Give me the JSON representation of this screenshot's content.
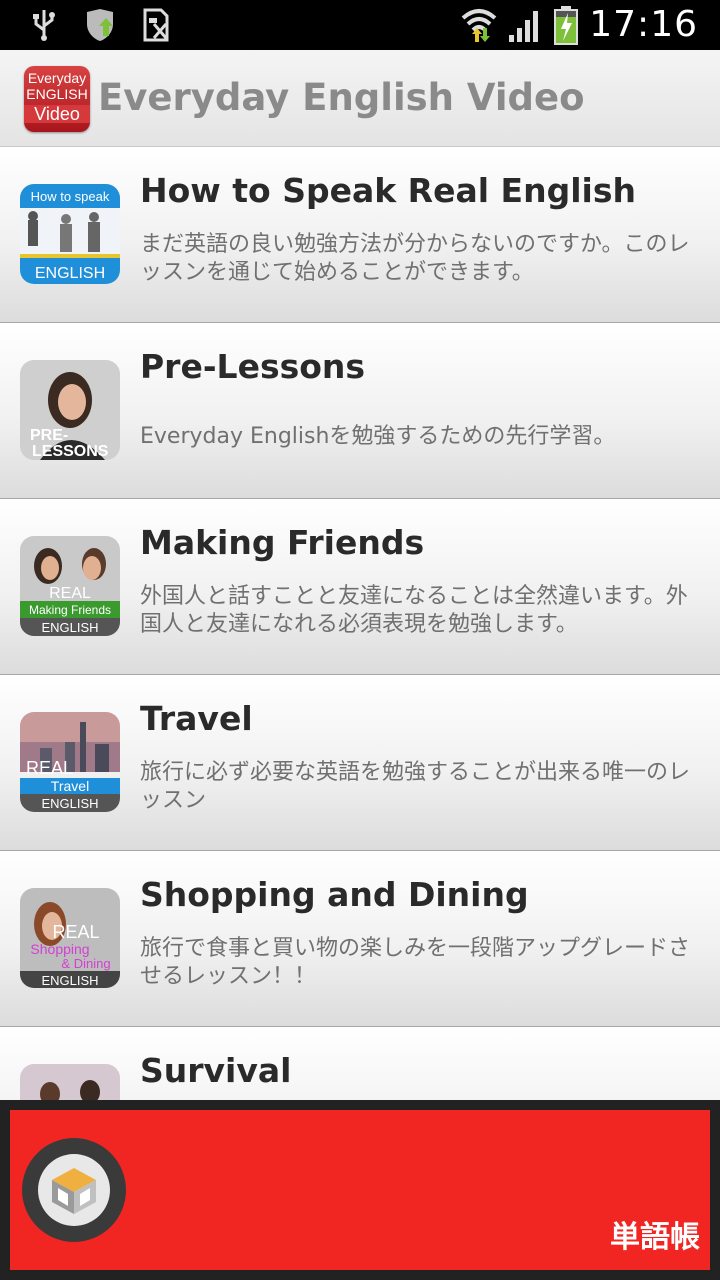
{
  "status_bar": {
    "time": "17:16"
  },
  "header": {
    "logo_lines": [
      "Everyday",
      "ENGLISH",
      "Video"
    ],
    "title": "Everyday English Video"
  },
  "lessons": [
    {
      "title": "How to Speak Real English",
      "description": "まだ英語の良い勉強方法が分からないのですか。このレッスンを通じて始めることができます。",
      "thumb_text": [
        "How to speak",
        "ENGLISH"
      ]
    },
    {
      "title": "Pre-Lessons",
      "description": "Everyday Englishを勉強するための先行学習。",
      "thumb_text": [
        "PRE-",
        "LESSONS"
      ]
    },
    {
      "title": "Making Friends",
      "description": "外国人と話すことと友達になることは全然違います。外国人と友達になれる必須表現を勉強します。",
      "thumb_text": [
        "REAL",
        "Making Friends",
        "ENGLISH"
      ]
    },
    {
      "title": "Travel",
      "description": "旅行に必ず必要な英語を勉強することが出来る唯一のレッスン",
      "thumb_text": [
        "REAL",
        "Travel",
        "ENGLISH"
      ]
    },
    {
      "title": "Shopping and Dining",
      "description": "旅行で食事と買い物の楽しみを一段階アップグレードさせるレッスン！！",
      "thumb_text": [
        "REAL",
        "Shopping",
        "& Dining",
        "ENGLISH"
      ]
    },
    {
      "title": "Survival",
      "description": "",
      "thumb_text": []
    }
  ],
  "ad": {
    "label": "単語帳"
  },
  "colors": {
    "ad_red": "#f12623",
    "title_gray": "#8a8a8a"
  }
}
